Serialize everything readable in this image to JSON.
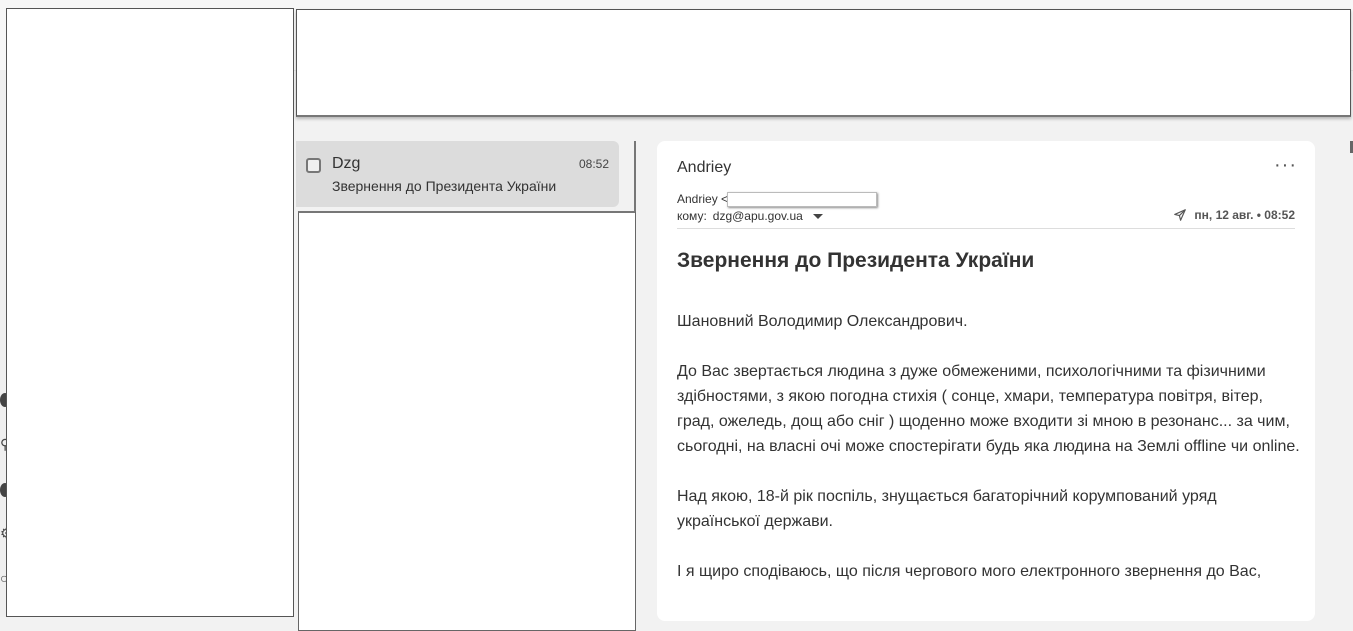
{
  "message_list": {
    "items": [
      {
        "sender": "Dzg",
        "time": "08:52",
        "subject": "Звернення до Президента України"
      }
    ]
  },
  "reader": {
    "from_name": "Andriey",
    "from_line": "Andriey <",
    "to_label": "кому:",
    "to_address": "dzg@apu.gov.ua",
    "sent_date": "пн, 12 авг. • 08:52",
    "more_label": "···",
    "subject": "Звернення до Президента України",
    "body": [
      "Шановний Володимир Олександрович.",
      "До Вас звертається людина з дуже обмеженими, психологічними та фізичними здібностями, з якою погодна стихія ( сонце, хмари, температура повітря, вітер, град, ожеледь, дощ або сніг ) щоденно може входити зі мною в резонанс... за чим, сьогодні, на власні очі може спостерігати будь яка людина на Землі offline чи online.",
      "Над якою, 18-й рік поспіль, знущається багаторічний корумпований уряд української держави.",
      "І я щиро сподіваюсь, що після чергового мого електронного звернення до Вас,"
    ]
  },
  "icons": {
    "checkbox": "checkbox-icon",
    "send": "send-icon",
    "more": "more-horizontal-icon",
    "dropdown": "chevron-down-icon"
  }
}
